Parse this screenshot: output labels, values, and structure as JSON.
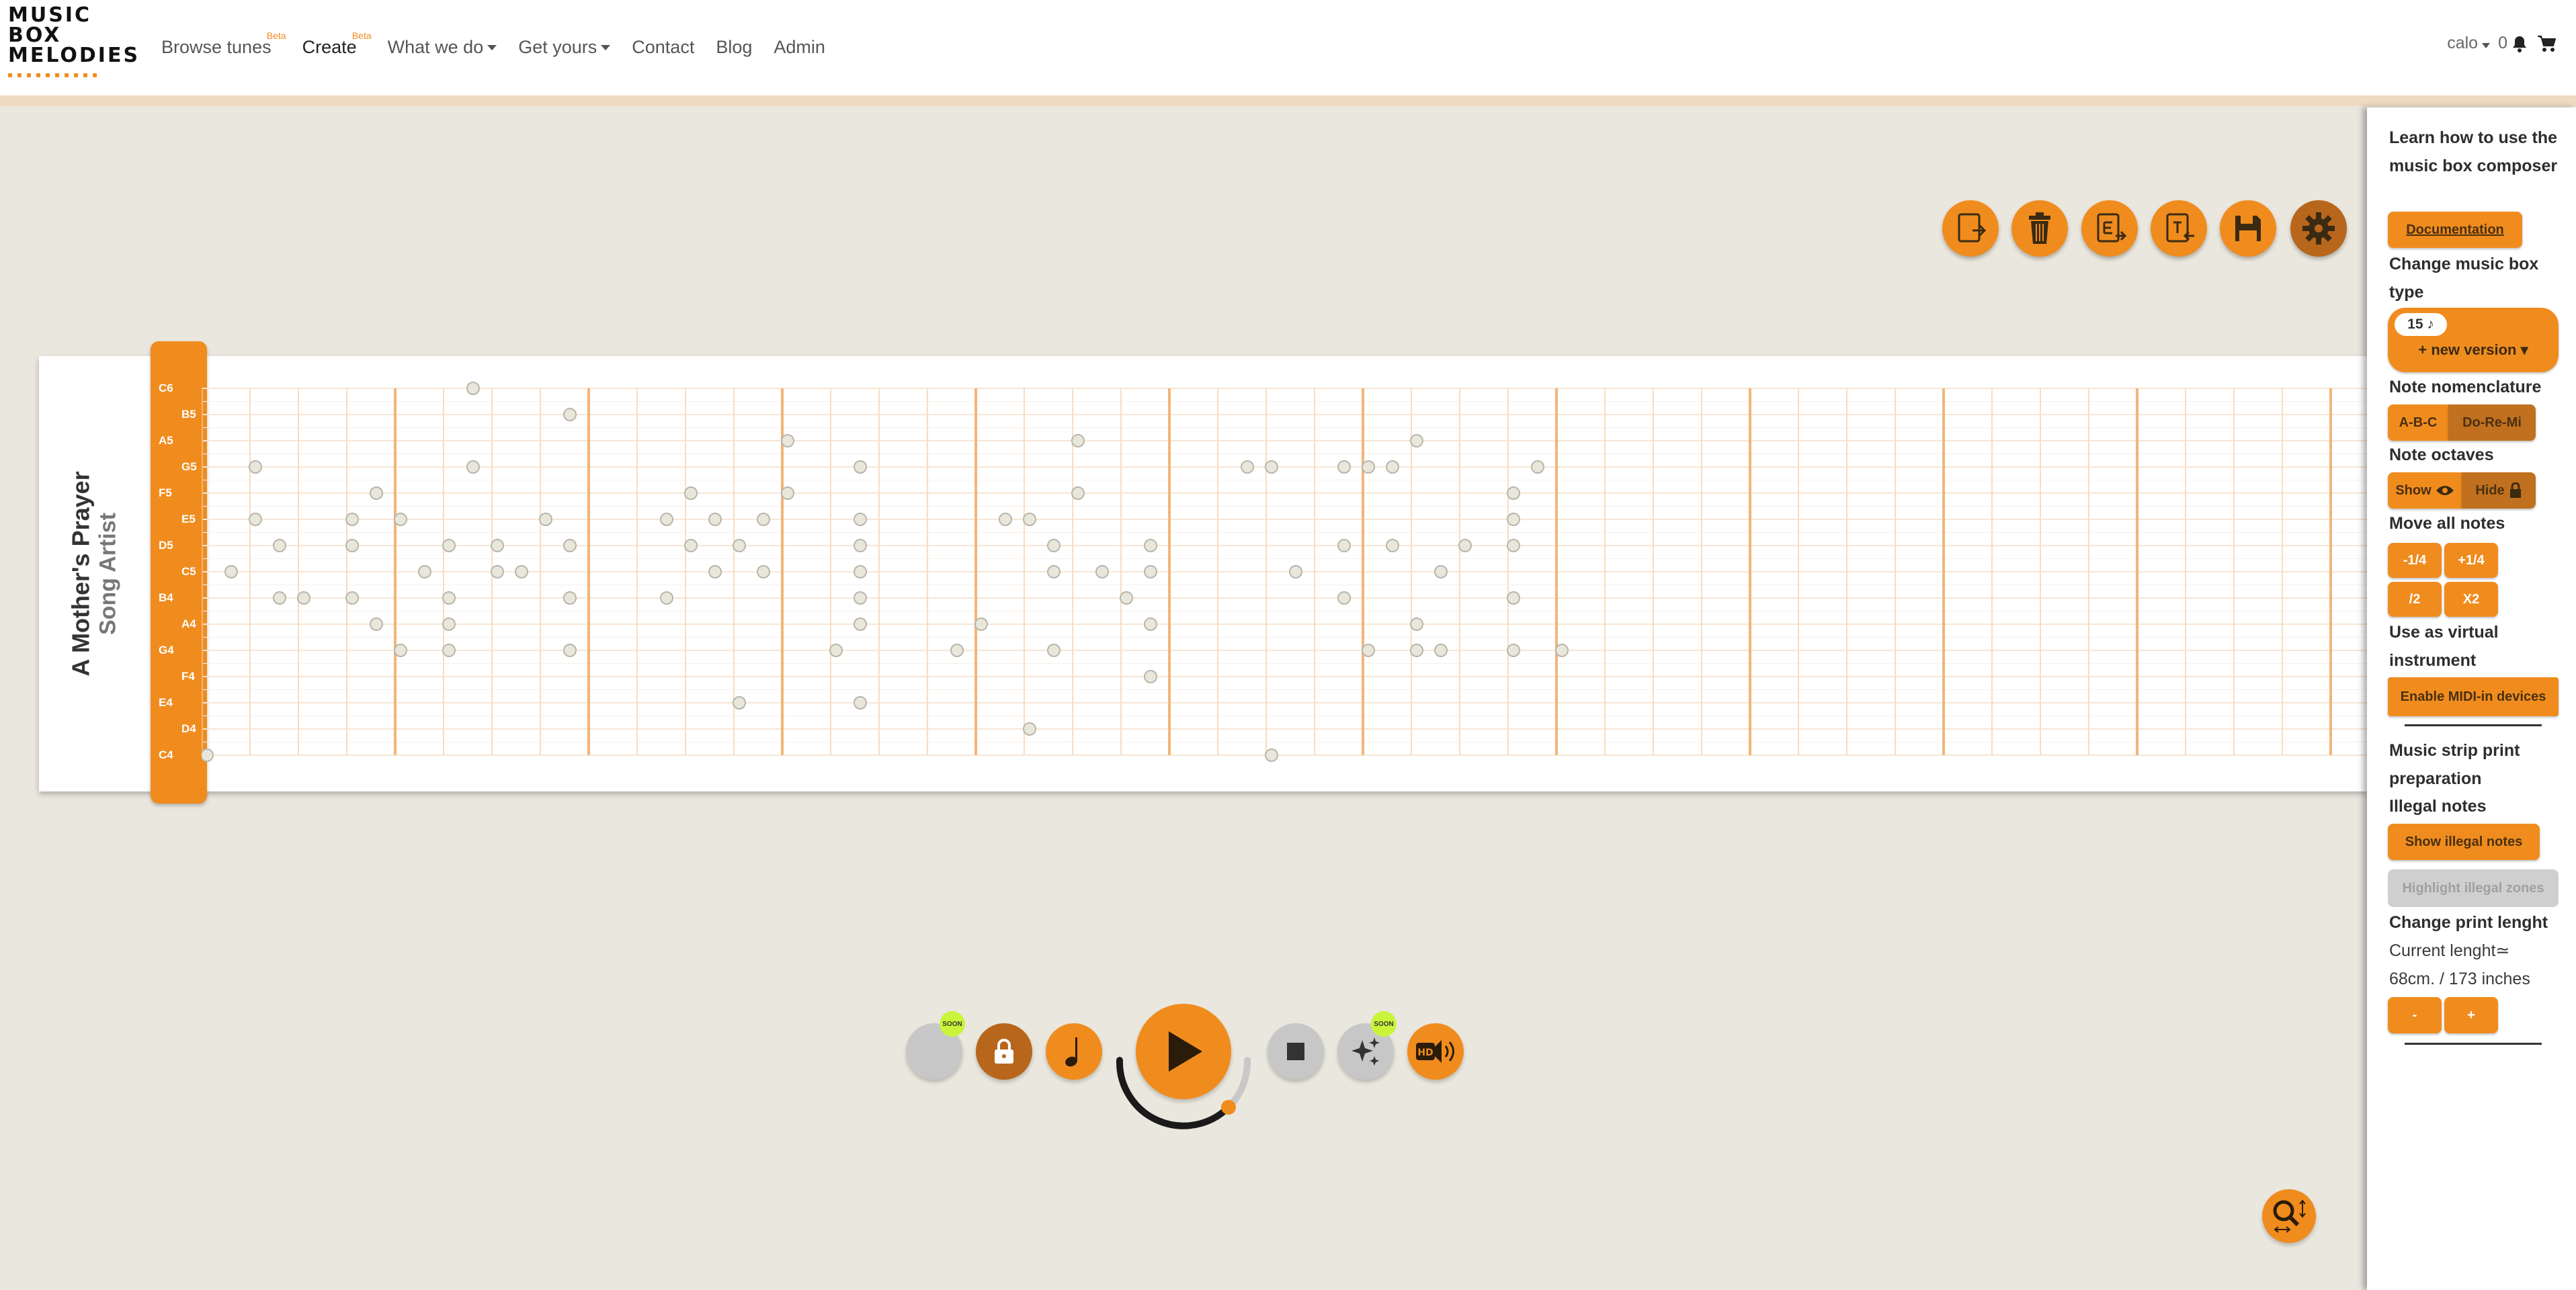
{
  "logo": {
    "line1": "MUSIC",
    "line2": "BOX",
    "line3": "MELODIES"
  },
  "nav": {
    "browse": "Browse tunes",
    "browse_badge": "Beta",
    "create": "Create",
    "create_badge": "Beta",
    "what": "What we do",
    "get": "Get yours",
    "contact": "Contact",
    "blog": "Blog",
    "admin": "Admin"
  },
  "user": {
    "name": "calo",
    "notifications": "0"
  },
  "toolbar": {
    "icons": [
      "load-icon",
      "trash-icon",
      "export-icon",
      "import-icon",
      "save-icon",
      "gear-icon"
    ]
  },
  "song": {
    "title": "A Mother's Prayer",
    "artist": "Song Artist"
  },
  "notes": [
    "C6",
    "B5",
    "A5",
    "G5",
    "F5",
    "E5",
    "D5",
    "C5",
    "B4",
    "A4",
    "G4",
    "F4",
    "E4",
    "D4",
    "C4"
  ],
  "strip_notes": [
    [
      0,
      14
    ],
    [
      1,
      7
    ],
    [
      2,
      3
    ],
    [
      2,
      5
    ],
    [
      3,
      6
    ],
    [
      3,
      8
    ],
    [
      4,
      8
    ],
    [
      6,
      5
    ],
    [
      6,
      6
    ],
    [
      6,
      8
    ],
    [
      7,
      4
    ],
    [
      7,
      9
    ],
    [
      8,
      5
    ],
    [
      8,
      10
    ],
    [
      9,
      7
    ],
    [
      10,
      6
    ],
    [
      10,
      8
    ],
    [
      10,
      9
    ],
    [
      10,
      10
    ],
    [
      11,
      0
    ],
    [
      11,
      3
    ],
    [
      12,
      6
    ],
    [
      12,
      7
    ],
    [
      13,
      7
    ],
    [
      14,
      5
    ],
    [
      15,
      1
    ],
    [
      15,
      6
    ],
    [
      15,
      8
    ],
    [
      15,
      10
    ],
    [
      19,
      5
    ],
    [
      19,
      8
    ],
    [
      20,
      4
    ],
    [
      20,
      6
    ],
    [
      21,
      5
    ],
    [
      21,
      7
    ],
    [
      22,
      6
    ],
    [
      22,
      12
    ],
    [
      23,
      5
    ],
    [
      23,
      7
    ],
    [
      24,
      4
    ],
    [
      24,
      2
    ],
    [
      26,
      10
    ],
    [
      27,
      3
    ],
    [
      27,
      5
    ],
    [
      27,
      6
    ],
    [
      27,
      7
    ],
    [
      27,
      8
    ],
    [
      27,
      9
    ],
    [
      27,
      12
    ],
    [
      31,
      10
    ],
    [
      32,
      9
    ],
    [
      33,
      5
    ],
    [
      34,
      5
    ],
    [
      34,
      13
    ],
    [
      35,
      6
    ],
    [
      35,
      7
    ],
    [
      35,
      10
    ],
    [
      36,
      2
    ],
    [
      36,
      4
    ],
    [
      37,
      7
    ],
    [
      38,
      8
    ],
    [
      39,
      6
    ],
    [
      39,
      7
    ],
    [
      39,
      9
    ],
    [
      39,
      11
    ],
    [
      43,
      3
    ],
    [
      44,
      3
    ],
    [
      44,
      14
    ],
    [
      45,
      7
    ],
    [
      47,
      3
    ],
    [
      47,
      6
    ],
    [
      47,
      8
    ],
    [
      48,
      3
    ],
    [
      48,
      10
    ],
    [
      49,
      3
    ],
    [
      49,
      6
    ],
    [
      50,
      10
    ],
    [
      50,
      2
    ],
    [
      50,
      9
    ],
    [
      51,
      7
    ],
    [
      51,
      10
    ],
    [
      52,
      6
    ],
    [
      54,
      5
    ],
    [
      54,
      6
    ],
    [
      54,
      8
    ],
    [
      54,
      10
    ],
    [
      54,
      4
    ],
    [
      55,
      3
    ],
    [
      56,
      10
    ]
  ],
  "settings": {
    "learn": "Learn how to use the music box composer",
    "doc": "Documentation",
    "change_type": "Change music box type",
    "box_type": "15 ♪",
    "new_version": "+ new version",
    "nomenclature": "Note nomenclature",
    "abc": "A-B-C",
    "doremi": "Do-Re-Mi",
    "octaves": "Note octaves",
    "show": "Show",
    "hide": "Hide",
    "move": "Move all notes",
    "m1": "-1/4",
    "m2": "+1/4",
    "m3": "/2",
    "m4": "X2",
    "virtual": "Use as virtual instrument",
    "midi": "Enable MIDI-in devices",
    "print_prep": "Music strip print preparation",
    "illegal": "Illegal notes",
    "show_illegal": "Show illegal notes",
    "highlight": "Highlight illegal zones",
    "print_len": "Change print lenght",
    "current": "Current lenght≃",
    "length": "68cm. / 173 inches",
    "minus": "-",
    "plus": "+"
  },
  "player": {
    "soon": "SOON",
    "hd": "HD"
  },
  "colors": {
    "accent": "#f08c1e",
    "accent_dark": "#b8661b",
    "background": "#eae7de",
    "soon": "#c9f43a"
  }
}
